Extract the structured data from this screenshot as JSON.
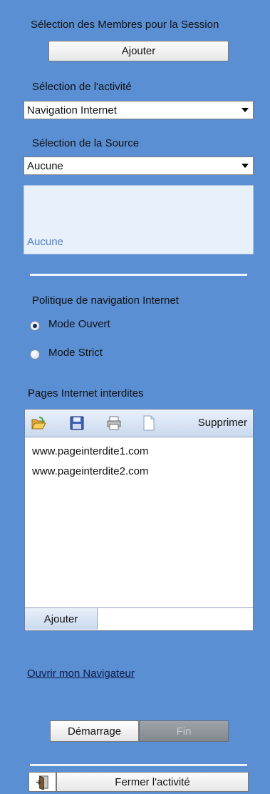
{
  "members": {
    "label": "Sélection des Membres pour la Session",
    "add_button": "Ajouter"
  },
  "activity": {
    "label": "Sélection de l'activité",
    "selected": "Navigation Internet"
  },
  "source": {
    "label": "Sélection de la Source",
    "selected": "Aucune",
    "preview_text": "Aucune"
  },
  "policy": {
    "label": "Politique de navigation Internet",
    "options": [
      {
        "label": "Mode Ouvert",
        "checked": true
      },
      {
        "label": "Mode Strict",
        "checked": false
      }
    ]
  },
  "blocked_pages": {
    "label": "Pages Internet interdites",
    "toolbar": {
      "delete_label": "Supprimer"
    },
    "items": [
      "www.pageinterdite1.com",
      "www.pageinterdite2.com"
    ],
    "add_button": "Ajouter"
  },
  "open_browser_link": "Ouvrir mon Navigateur",
  "controls": {
    "start": "Démarrage",
    "end": "Fin"
  },
  "close_activity": "Fermer l'activité",
  "colors": {
    "background": "#5b8fd4",
    "panel_light": "#e8f0fb",
    "accent_text": "#4a7fc1"
  }
}
